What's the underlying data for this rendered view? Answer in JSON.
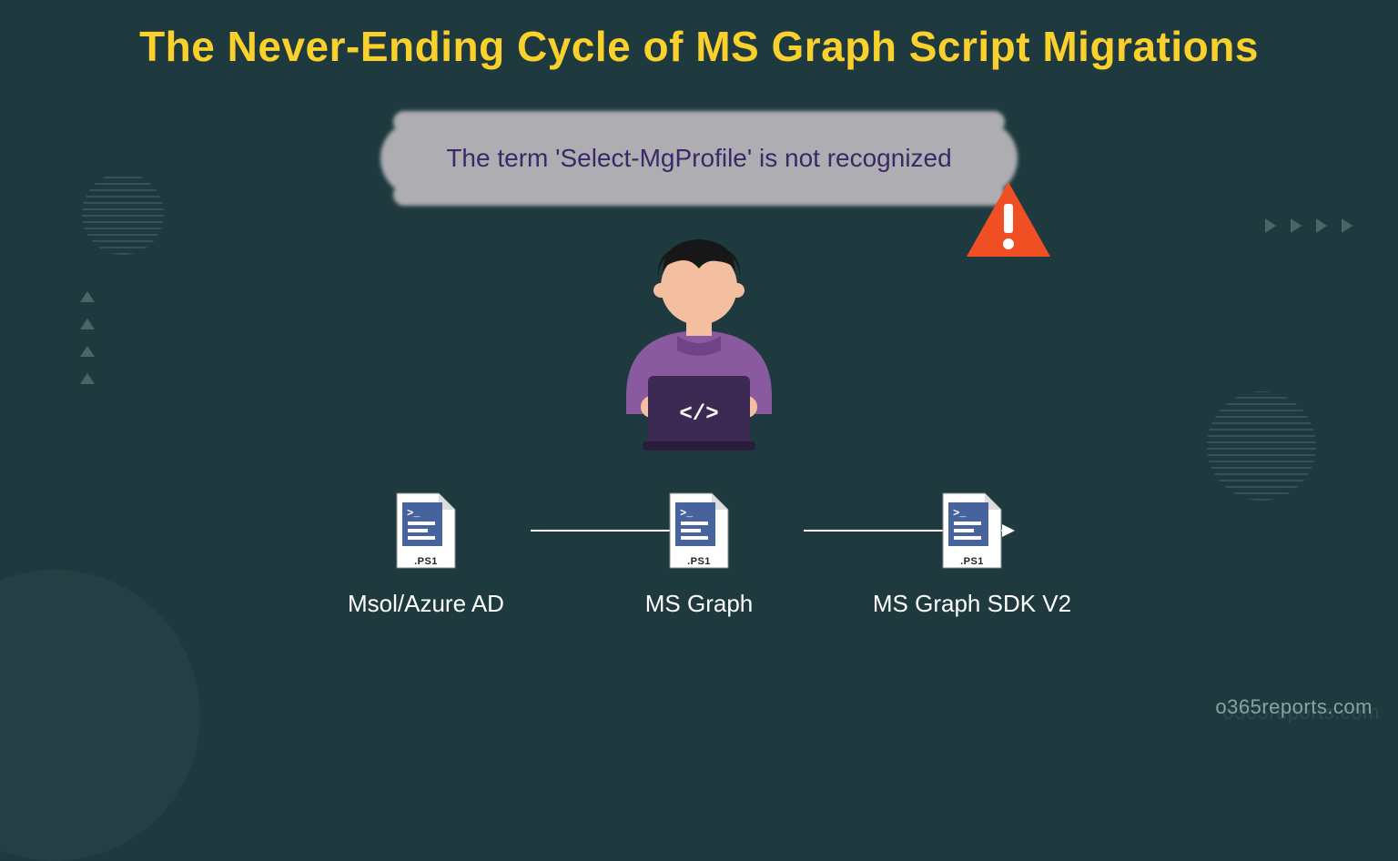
{
  "title": "The Never-Ending Cycle of MS Graph Script Migrations",
  "error_message": "The term 'Select-MgProfile' is not recognized",
  "file_ext": ".PS1",
  "nodes": {
    "n1": "Msol/Azure AD",
    "n2": "MS Graph",
    "n3": "MS Graph SDK V2"
  },
  "watermark": "o365reports.com",
  "colors": {
    "bg": "#1f3a3f",
    "title": "#FAD02C",
    "alert": "#f04e23",
    "shirt": "#8a5a9e",
    "laptop": "#3c2a52"
  }
}
